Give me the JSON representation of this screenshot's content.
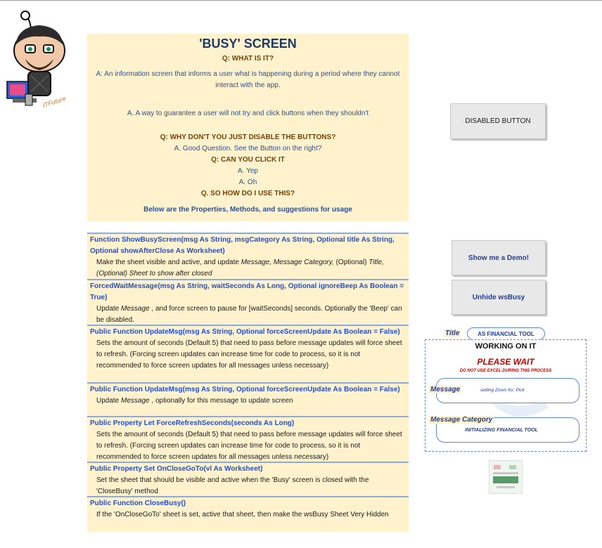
{
  "avatar": {
    "caption": "ITFuture"
  },
  "intro": {
    "title": "'BUSY' SCREEN",
    "q1": "Q: WHAT IS IT?",
    "a1": "A: An information screen that informs a user what is happening during a period where they cannot interact with the app.",
    "a1b": "A. A way to guarantee a user will not try and click buttons when they shouldn't",
    "q2": "Q: WHY DON'T YOU JUST DISABLE THE BUTTONS?",
    "a2": "A. Good Question.  See the Button on the right?",
    "q3": "Q: CAN YOU CLICK IT",
    "a3": "A. Yep",
    "a4": "A. Oh",
    "q4": "Q. SO HOW DO I USE THIS?",
    "footer": "Below are the Properties, Methods, and suggestions for usage"
  },
  "docs": [
    {
      "sig": "Function ShowBusyScreen(msg As String, msgCategory As String, Optional title As String, Optional showAfterClose As Worksheet)",
      "d1": "Make the sheet visible and active, and update ",
      "d1i": "Message, Message Category,",
      "d1b": " (Optional) ",
      "d1j": "Title, (Optional) Sheet to show after closed"
    },
    {
      "sig": "ForcedWaitMessage(msg As String, waitSeconds As Long, Optional ignoreBeep As Boolean = True)",
      "d1": "Update ",
      "d1i": "Message",
      "d1b": " , and force screen to pause for [waitSeconds] seconds.  Optionally the 'Beep' can be disabled."
    },
    {
      "sig": "Public Function UpdateMsg(msg As String, Optional forceScreenUpdate As Boolean = False)",
      "d1": "Sets the amount of seconds (Default 5) that need to pass before message updates will force sheet to refresh.  (Forcing screen updates can increase time for code to process, so it is not recommended to force screen updates for all messages unless necessary)"
    },
    {
      "sig": "Public Function UpdateMsg(msg As String, Optional forceScreenUpdate As Boolean = False)",
      "d1": "Update ",
      "d1i": "Message",
      "d1b": " , optionally for this message to update screen"
    },
    {
      "sig": "Public Property Let ForceRefreshSeconds(seconds As Long)",
      "d1": "Sets the amount of seconds (Default 5) that need to pass before message updates will force sheet to refresh.  (Forcing screen updates can increase time for code to process, so it is not recommended to force screen updates for all messages unless necessary)"
    },
    {
      "sig": "Public Property Set OnCloseGoTo(vl As Worksheet)",
      "d1": "Set the sheet that should be visible and active when the 'Busy' screen is closed with the 'CloseBusy' method"
    },
    {
      "sig": "Public Function CloseBusy()",
      "d1": "If the 'OnCloseGoTo' sheet is set, active that sheet, then make the wsBusy Sheet Very Hidden"
    }
  ],
  "buttons": {
    "disabled": "DISABLED BUTTON",
    "demo": "Show me a Demo!",
    "unhide": "Unhide wsBusy"
  },
  "busy": {
    "title_label": "Title",
    "title_value": "AS FINANCIAL TOOL",
    "working": "WORKING ON IT",
    "please_wait": "PLEASE WAIT",
    "warning": "DO NOT USE EXCEL DURING THIS PROCESS",
    "message_label": "Message",
    "message_value": "setting Zoom for: Pick",
    "category_label": "Message Category",
    "category_value": "INITIALIZING FINANCIAL TOOL"
  },
  "colors": {
    "panel": "#fff2cc",
    "heading": "#7b3f00",
    "signature": "#1f4fd8",
    "accent_red": "#c00000",
    "border_blue": "#5b8ad6"
  }
}
